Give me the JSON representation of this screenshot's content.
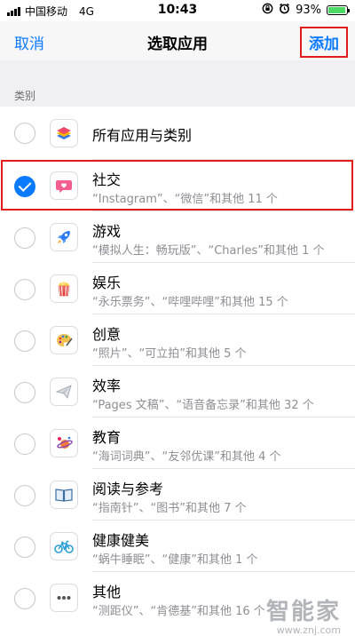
{
  "status_bar": {
    "carrier": "中国移动",
    "network": "4G",
    "time": "10:43",
    "battery_percent": "93%",
    "battery_level": 0.93
  },
  "nav": {
    "cancel_label": "取消",
    "title": "选取应用",
    "add_label": "添加"
  },
  "section_header": "类别",
  "categories": [
    {
      "title": "所有应用与类别",
      "subtitle": "",
      "icon": "layers-icon",
      "checked": false
    },
    {
      "title": "社交",
      "subtitle": "“Instagram”、“微信”和其他 11 个",
      "icon": "chat-bubble-heart-icon",
      "checked": true
    },
    {
      "title": "游戏",
      "subtitle": "“模拟人生：畅玩版”、“Charles”和其他 1 个",
      "icon": "rocket-icon",
      "checked": false
    },
    {
      "title": "娱乐",
      "subtitle": "“永乐票务”、“哔哩哔哩”和其他 15 个",
      "icon": "popcorn-icon",
      "checked": false
    },
    {
      "title": "创意",
      "subtitle": "“照片”、“可立拍”和其他 5 个",
      "icon": "palette-icon",
      "checked": false
    },
    {
      "title": "效率",
      "subtitle": "“Pages 文稿”、“语音备忘录”和其他 32 个",
      "icon": "paper-plane-icon",
      "checked": false
    },
    {
      "title": "教育",
      "subtitle": "“海词词典”、“友邻优课”和其他 4 个",
      "icon": "planet-icon",
      "checked": false
    },
    {
      "title": "阅读与参考",
      "subtitle": "“指南针”、“图书”和其他 7 个",
      "icon": "book-icon",
      "checked": false
    },
    {
      "title": "健康健美",
      "subtitle": "“蜗牛睡眠”、“健康”和其他 1 个",
      "icon": "bicycle-icon",
      "checked": false
    },
    {
      "title": "其他",
      "subtitle": "“测距仪”、“肯德基”和其他 16 个",
      "icon": "ellipsis-icon",
      "checked": false
    }
  ],
  "watermark": {
    "text": "智能家",
    "url": "www.znj.com"
  },
  "colors": {
    "accent": "#0a7aff",
    "highlight": "#e21b1b"
  }
}
